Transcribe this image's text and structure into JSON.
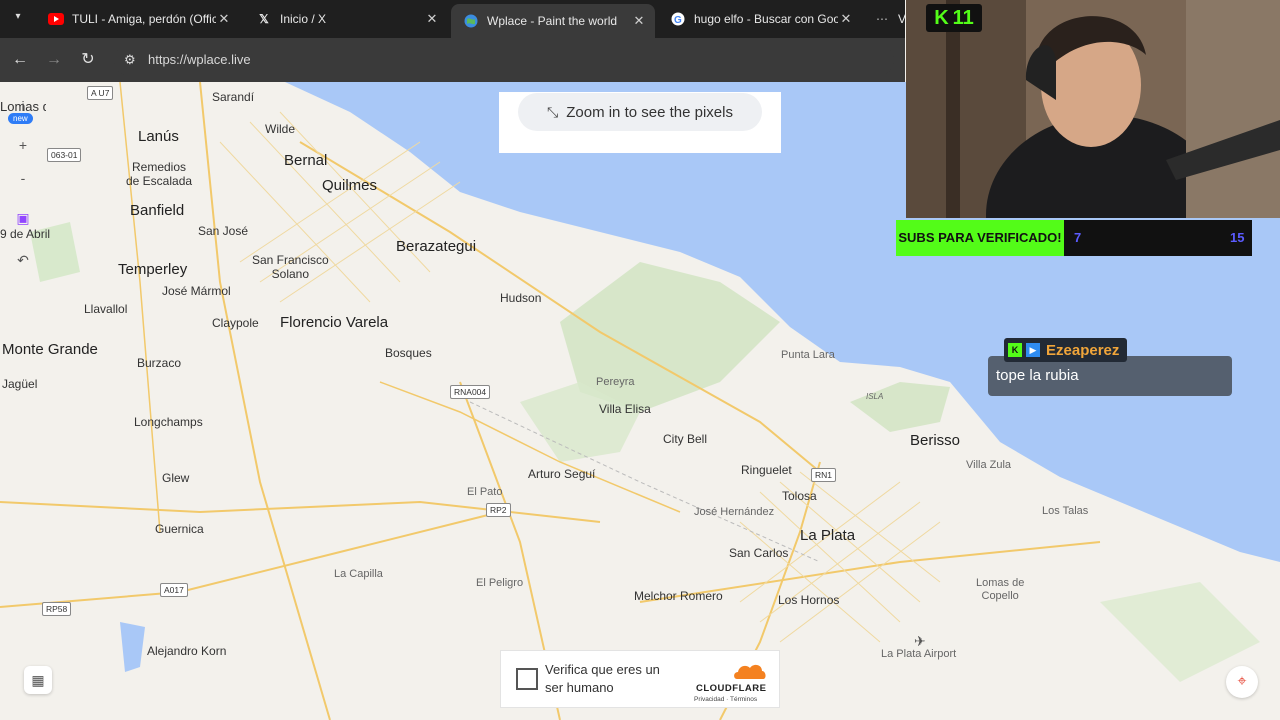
{
  "browser": {
    "tabs": [
      {
        "title": "TULI - Amiga, perdón (Offici",
        "icon": "youtube-icon"
      },
      {
        "title": "Inicio / X",
        "icon": "x-icon"
      },
      {
        "title": "Wplace - Paint the world",
        "icon": "globe-icon",
        "active": true
      },
      {
        "title": "hugo elfo - Buscar con Goog",
        "icon": "google-icon"
      },
      {
        "title": "Va",
        "icon": "dots-icon"
      }
    ],
    "url": "https://wplace.live"
  },
  "notice": {
    "text": "Zoom in to see the pixels"
  },
  "left_controls": {
    "new_badge": "new",
    "info": "i",
    "zoom_in": "+",
    "zoom_out": "-"
  },
  "map": {
    "labels": [
      {
        "text": "Sarandí"
      },
      {
        "text": "Lanús"
      },
      {
        "text": "Wilde"
      },
      {
        "text": "Bernal"
      },
      {
        "text": "Quilmes"
      },
      {
        "text": "Remedios\nde Escalada"
      },
      {
        "text": "Banfield"
      },
      {
        "text": "San José"
      },
      {
        "text": "Berazategui"
      },
      {
        "text": "Temperley"
      },
      {
        "text": "San Francisco\nSolano"
      },
      {
        "text": "José Mármol"
      },
      {
        "text": "Hudson"
      },
      {
        "text": "Llavallol"
      },
      {
        "text": "Claypole"
      },
      {
        "text": "Florencio Varela"
      },
      {
        "text": "Monte Grande"
      },
      {
        "text": "Bosques"
      },
      {
        "text": "Burzaco"
      },
      {
        "text": "Punta Lara"
      },
      {
        "text": "Jagüel"
      },
      {
        "text": "Pereyra"
      },
      {
        "text": "Villa Elisa"
      },
      {
        "text": "Longchamps"
      },
      {
        "text": "City Bell"
      },
      {
        "text": "Berisso"
      },
      {
        "text": "Villa Zula"
      },
      {
        "text": "Arturo Seguí"
      },
      {
        "text": "Ringuelet"
      },
      {
        "text": "Glew"
      },
      {
        "text": "El Pato"
      },
      {
        "text": "Tolosa"
      },
      {
        "text": "José Hernández"
      },
      {
        "text": "Los Talas"
      },
      {
        "text": "La Plata"
      },
      {
        "text": "Guernica"
      },
      {
        "text": "San Carlos"
      },
      {
        "text": "La Capilla"
      },
      {
        "text": "El Peligro"
      },
      {
        "text": "Lomas de\nCopello"
      },
      {
        "text": "Melchor Romero"
      },
      {
        "text": "Los Hornos"
      },
      {
        "text": "Alejandro Korn"
      },
      {
        "text": "La Plata Airport"
      },
      {
        "text": "Lomas de Zamora"
      },
      {
        "text": "9 de Abril"
      },
      {
        "text": "ISLA"
      }
    ],
    "shields": [
      "A U7",
      "063-01",
      "RNA004",
      "RN1",
      "RP2",
      "A017",
      "RP58"
    ]
  },
  "captcha": {
    "label": "Verifica que eres un ser humano",
    "brand": "CLOUDFLARE",
    "links": "Privacidad · Términos"
  },
  "overlay": {
    "kick_count": "11",
    "subs_label": "SUBS PARA VERIFICADO!",
    "subs_current": "7",
    "subs_goal": "15",
    "chat_user": "Ezeaperez",
    "chat_message": "tope la rubia"
  },
  "colors": {
    "water": "#a9c8f7",
    "land": "#f3f1ec",
    "green": "#53fc18",
    "accent": "#2e7cf6"
  }
}
